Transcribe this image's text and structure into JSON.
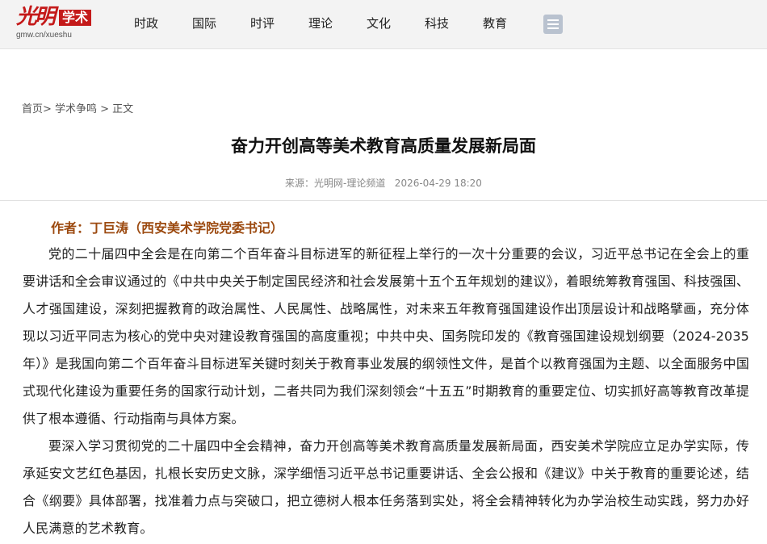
{
  "site": {
    "logo_script": "光明",
    "logo_box": "学术",
    "logo_url": "gmw.cn/xueshu"
  },
  "nav": {
    "items": [
      "时政",
      "国际",
      "时评",
      "理论",
      "文化",
      "科技",
      "教育"
    ]
  },
  "breadcrumb": "首页> 学术争鸣 > 正文",
  "article": {
    "title": "奋力开创高等美术教育高质量发展新局面",
    "meta": "来源：光明网-理论频道   2026-04-29 18:20",
    "author": "作者：丁巨涛（西安美术学院党委书记）",
    "paragraphs": [
      "党的二十届四中全会是在向第二个百年奋斗目标进军的新征程上举行的一次十分重要的会议，习近平总书记在全会上的重要讲话和全会审议通过的《中共中央关于制定国民经济和社会发展第十五个五年规划的建议》，着眼统筹教育强国、科技强国、人才强国建设，深刻把握教育的政治属性、人民属性、战略属性，对未来五年教育强国建设作出顶层设计和战略擘画，充分体现以习近平同志为核心的党中央对建设教育强国的高度重视；中共中央、国务院印发的《教育强国建设规划纲要（2024-2035年）》是我国向第二个百年奋斗目标进军关键时刻关于教育事业发展的纲领性文件，是首个以教育强国为主题、以全面服务中国式现代化建设为重要任务的国家行动计划，二者共同为我们深刻领会“十五五”时期教育的重要定位、切实抓好高等教育改革提供了根本遵循、行动指南与具体方案。",
      "要深入学习贯彻党的二十届四中全会精神，奋力开创高等美术教育高质量发展新局面，西安美术学院应立足办学实际，传承延安文艺红色基因，扎根长安历史文脉，深学细悟习近平总书记重要讲话、全会公报和《建议》中关于教育的重要论述，结合《纲要》具体部署，找准着力点与突破口，把立德树人根本任务落到实处，将全会精神转化为办学治校生动实践，努力办好人民满意的艺术教育。"
    ]
  }
}
